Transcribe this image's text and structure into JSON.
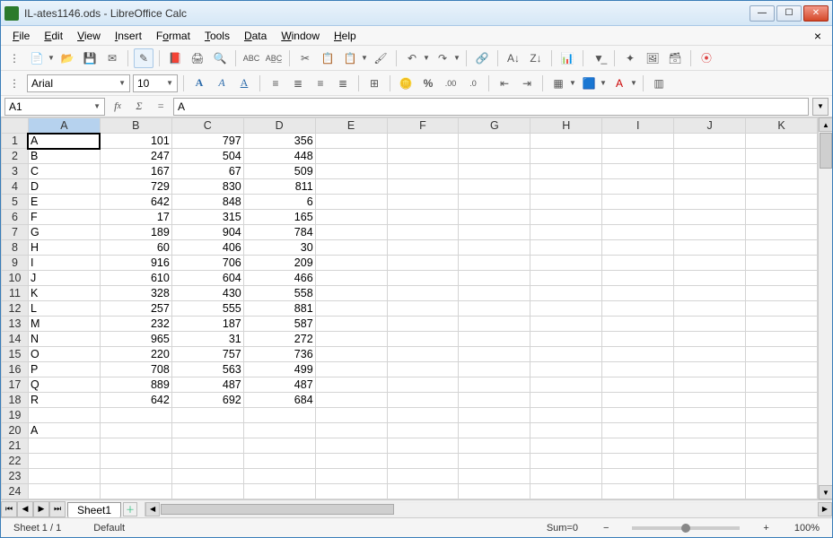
{
  "window": {
    "title": "IL-ates1146.ods - LibreOffice Calc"
  },
  "menu": {
    "file": "File",
    "edit": "Edit",
    "view": "View",
    "insert": "Insert",
    "format": "Format",
    "tools": "Tools",
    "data": "Data",
    "window": "Window",
    "help": "Help"
  },
  "font": {
    "name": "Arial",
    "size": "10"
  },
  "namebox": "A1",
  "formula": "A",
  "columns": [
    "A",
    "B",
    "C",
    "D",
    "E",
    "F",
    "G",
    "H",
    "I",
    "J",
    "K"
  ],
  "rows": [
    1,
    2,
    3,
    4,
    5,
    6,
    7,
    8,
    9,
    10,
    11,
    12,
    13,
    14,
    15,
    16,
    17,
    18,
    19,
    20,
    21,
    22,
    23,
    24
  ],
  "cells": {
    "1": {
      "A": "A",
      "B": "101",
      "C": "797",
      "D": "356"
    },
    "2": {
      "A": "B",
      "B": "247",
      "C": "504",
      "D": "448"
    },
    "3": {
      "A": "C",
      "B": "167",
      "C": "67",
      "D": "509"
    },
    "4": {
      "A": "D",
      "B": "729",
      "C": "830",
      "D": "811"
    },
    "5": {
      "A": "E",
      "B": "642",
      "C": "848",
      "D": "6"
    },
    "6": {
      "A": "F",
      "B": "17",
      "C": "315",
      "D": "165"
    },
    "7": {
      "A": "G",
      "B": "189",
      "C": "904",
      "D": "784"
    },
    "8": {
      "A": "H",
      "B": "60",
      "C": "406",
      "D": "30"
    },
    "9": {
      "A": "I",
      "B": "916",
      "C": "706",
      "D": "209"
    },
    "10": {
      "A": "J",
      "B": "610",
      "C": "604",
      "D": "466"
    },
    "11": {
      "A": "K",
      "B": "328",
      "C": "430",
      "D": "558"
    },
    "12": {
      "A": "L",
      "B": "257",
      "C": "555",
      "D": "881"
    },
    "13": {
      "A": "M",
      "B": "232",
      "C": "187",
      "D": "587"
    },
    "14": {
      "A": "N",
      "B": "965",
      "C": "31",
      "D": "272"
    },
    "15": {
      "A": "O",
      "B": "220",
      "C": "757",
      "D": "736"
    },
    "16": {
      "A": "P",
      "B": "708",
      "C": "563",
      "D": "499"
    },
    "17": {
      "A": "Q",
      "B": "889",
      "C": "487",
      "D": "487"
    },
    "18": {
      "A": "R",
      "B": "642",
      "C": "692",
      "D": "684"
    },
    "19": {},
    "20": {
      "A": "A"
    },
    "21": {},
    "22": {},
    "23": {},
    "24": {}
  },
  "active_cell": "A1",
  "tabs": {
    "sheet1": "Sheet1"
  },
  "status": {
    "sheet": "Sheet 1 / 1",
    "style": "Default",
    "sum": "Sum=0",
    "zoom": "100%"
  }
}
